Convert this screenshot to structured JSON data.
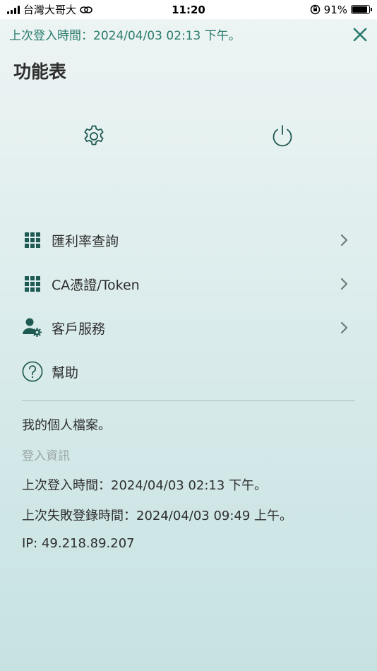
{
  "status_bar": {
    "carrier": "台灣大哥大",
    "time": "11:20",
    "battery_percent": "91%",
    "battery_level": 0.91
  },
  "header": {
    "last_login": "上次登入時間：2024/04/03 02:13 下午。",
    "title": "功能表"
  },
  "quick_actions": {
    "settings_icon": "gear-icon",
    "power_icon": "power-icon"
  },
  "menu": {
    "items": [
      {
        "label": "匯利率查詢",
        "icon": "grid-icon"
      },
      {
        "label": "CA憑證/Token",
        "icon": "grid-icon"
      },
      {
        "label": "客戶服務",
        "icon": "user-gear-icon"
      },
      {
        "label": "幫助",
        "icon": "help-circle-icon"
      }
    ]
  },
  "profile": {
    "link": "我的個人檔案。",
    "section_title": "登入資訊",
    "last_login": "上次登入時間：2024/04/03 02:13 下午。",
    "last_failed_login": "上次失敗登錄時間：2024/04/03 09:49 上午。",
    "ip": "IP: 49.218.89.207"
  },
  "colors": {
    "accent": "#2a7b6e",
    "icon_dark": "#1f5a52",
    "text": "#2e2e2e",
    "muted": "#9aa5a5"
  }
}
